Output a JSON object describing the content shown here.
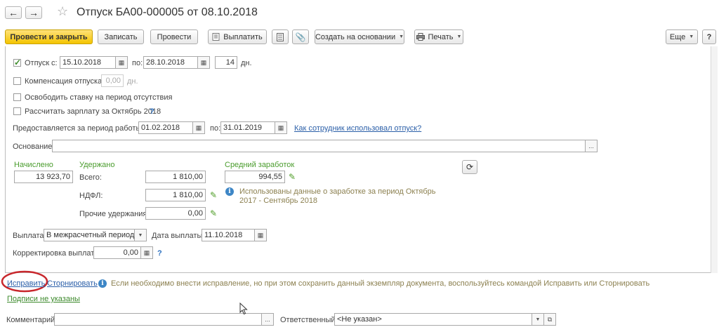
{
  "window": {
    "title": "Отпуск БА00-000005 от 08.10.2018"
  },
  "toolbar": {
    "post_close": "Провести и закрыть",
    "save": "Записать",
    "post": "Провести",
    "pay": "Выплатить",
    "create_based": "Создать на основании",
    "print": "Печать",
    "more": "Еще"
  },
  "vacation": {
    "label": "Отпуск",
    "from_label": "с:",
    "from": "15.10.2018",
    "to_label": "по:",
    "to": "28.10.2018",
    "days": "14",
    "days_unit": "дн."
  },
  "compensation": {
    "label": "Компенсация отпуска",
    "value": "0,00",
    "unit": "дн."
  },
  "release_rate": {
    "label": "Освободить ставку на период отсутствия"
  },
  "calc_salary": {
    "label": "Рассчитать зарплату за Октябрь 2018",
    "help": "?"
  },
  "work_period": {
    "label": "Предоставляется за период работы с:",
    "from": "01.02.2018",
    "to_label": "по:",
    "to": "31.01.2019",
    "link": "Как сотрудник использовал отпуск?"
  },
  "basis": {
    "label": "Основание:",
    "value": "",
    "btn": "..."
  },
  "accrued": {
    "header": "Начислено",
    "value": "13 923,70"
  },
  "withheld": {
    "header": "Удержано",
    "total_label": "Всего:",
    "total": "1 810,00",
    "ndfl_label": "НДФЛ:",
    "ndfl": "1 810,00",
    "other_label": "Прочие удержания:",
    "other": "0,00"
  },
  "avg_earnings": {
    "header": "Средний заработок",
    "value": "994,55",
    "note": "Использованы данные о заработке за период Октябрь 2017 - Сентябрь 2018"
  },
  "payment": {
    "label": "Выплата:",
    "value": "В межрасчетный период",
    "date_label": "Дата выплаты:",
    "date": "11.10.2018"
  },
  "correction": {
    "label": "Корректировка выплаты:",
    "value": "0,00",
    "help": "?"
  },
  "footer": {
    "fix_link": "Исправить",
    "reverse_link": "Сторнировать",
    "hint": "Если необходимо внести исправление, но при этом сохранить данный экземпляр документа, воспользуйтесь командой Исправить или Сторнировать",
    "signatures_link": "Подписи не указаны",
    "comment_label": "Комментарий:",
    "comment_value": "",
    "responsible_label": "Ответственный:",
    "responsible_value": "<Не указан>"
  },
  "colors": {
    "primary_button": "#f4c400",
    "accent_green": "#4a9c2d",
    "link_blue": "#2b5fa8",
    "highlight_circle": "#c8282d"
  }
}
